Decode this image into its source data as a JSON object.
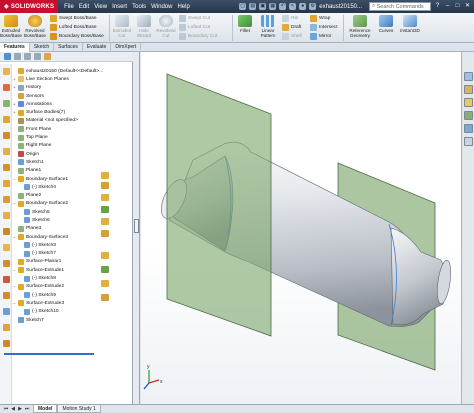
{
  "title_bar": {
    "logo": "SOLIDWORKS",
    "menus": [
      "File",
      "Edit",
      "View",
      "Insert",
      "Tools",
      "Window",
      "Help"
    ],
    "document": "exhaust20150...",
    "search_placeholder": "Search Commands"
  },
  "command_manager": {
    "extruded_boss": "Extruded Boss/Base",
    "revolved_boss": "Revolved Boss/Base",
    "swept_boss": "Swept Boss/Base",
    "lofted_boss": "Lofted Boss/Base",
    "boundary_boss": "Boundary Boss/Base",
    "extruded_cut": "Extruded Cut",
    "hole_wizard": "Hole Wizard",
    "revolved_cut": "Revolved Cut",
    "swept_cut": "Swept Cut",
    "lofted_cut": "Lofted Cut",
    "boundary_cut": "Boundary Cut",
    "fillet": "Fillet",
    "linear_pattern": "Linear Pattern",
    "rib": "Rib",
    "draft": "Draft",
    "shell": "Shell",
    "wrap": "Wrap",
    "intersect": "Intersect",
    "mirror": "Mirror",
    "reference_geometry": "Reference Geometry",
    "curves": "Curves",
    "instant3d": "Instant3D"
  },
  "tabs": [
    "Features",
    "Sketch",
    "Surfaces",
    "Evaluate",
    "DimXpert"
  ],
  "active_tab": "Features",
  "feature_tree": [
    {
      "label": "exhaust20150 (Default<<Default>..."
    },
    {
      "label": "Live Section Planes"
    },
    {
      "label": "History"
    },
    {
      "label": "Sensors"
    },
    {
      "label": "Annotations"
    },
    {
      "label": "Surface Bodies(7)"
    },
    {
      "label": "Material <not specified>"
    },
    {
      "label": "Front Plane"
    },
    {
      "label": "Top Plane"
    },
    {
      "label": "Right Plane"
    },
    {
      "label": "Origin"
    },
    {
      "label": "Sketch1"
    },
    {
      "label": "Plane1"
    },
    {
      "label": "Boundary-Surface1"
    },
    {
      "label": "(-) Sketch4"
    },
    {
      "label": "Plane2"
    },
    {
      "label": "Boundary-Surface2"
    },
    {
      "label": "Sketch5"
    },
    {
      "label": "Sketch6"
    },
    {
      "label": "Plane3"
    },
    {
      "label": "Boundary-Surface3"
    },
    {
      "label": "(-) Sketch3"
    },
    {
      "label": "(-) Sketch7"
    },
    {
      "label": "Surface-Planar1"
    },
    {
      "label": "Surface-Extrude1"
    },
    {
      "label": "(-) Sketch8"
    },
    {
      "label": "Surface-Extrude2"
    },
    {
      "label": "(-) Sketch9"
    },
    {
      "label": "Surface-Extrude3"
    },
    {
      "label": "(-) Sketch10"
    },
    {
      "label": "Sketch7"
    }
  ],
  "bottom_tabs": [
    "Model",
    "Motion Study 1"
  ],
  "active_bottom_tab": "Model",
  "triad_labels": {
    "x": "x",
    "y": "y"
  },
  "colors": {
    "logo_red": "#c8102e",
    "plane_green": "#7fa86e",
    "titlebar": "#26364a",
    "rollback_blue": "#2f6fcf"
  }
}
